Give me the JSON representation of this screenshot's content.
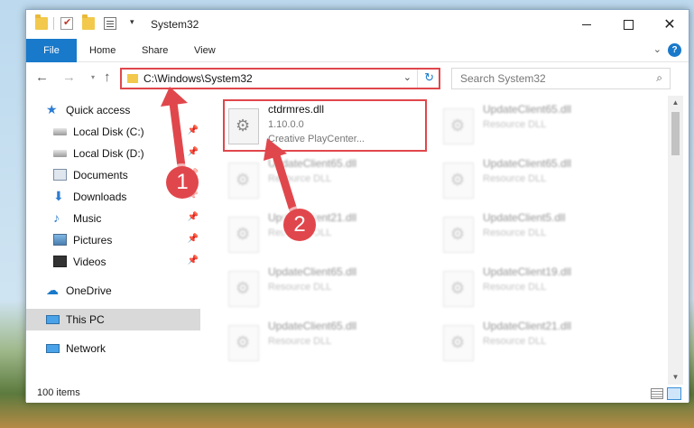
{
  "window": {
    "title": "System32",
    "controls": {
      "minimize": "minimize",
      "maximize": "maximize",
      "close": "✕"
    }
  },
  "ribbon": {
    "tabs": [
      "File",
      "Home",
      "Share",
      "View"
    ],
    "help": "?",
    "collapse_icon": "chevron-down-icon"
  },
  "nav": {
    "back": "←",
    "forward": "→",
    "recent": "▾",
    "up": "↑",
    "address": "C:\\Windows\\System32",
    "address_dropdown": "⌄",
    "refresh": "↻",
    "search_placeholder": "Search System32",
    "search_icon": "⌕"
  },
  "sidebar": {
    "items": [
      {
        "label": "Quick access",
        "icon": "star-icon",
        "pinned": false
      },
      {
        "label": "Local Disk (C:)",
        "icon": "disk-icon",
        "pinned": true
      },
      {
        "label": "Local Disk (D:)",
        "icon": "disk-icon",
        "pinned": true
      },
      {
        "label": "Documents",
        "icon": "documents-icon",
        "pinned": true
      },
      {
        "label": "Downloads",
        "icon": "download-icon",
        "pinned": true
      },
      {
        "label": "Music",
        "icon": "music-icon",
        "pinned": true
      },
      {
        "label": "Pictures",
        "icon": "pictures-icon",
        "pinned": true
      },
      {
        "label": "Videos",
        "icon": "videos-icon",
        "pinned": true
      },
      {
        "label": "OneDrive",
        "icon": "cloud-icon",
        "pinned": false
      },
      {
        "label": "This PC",
        "icon": "computer-icon",
        "pinned": false,
        "selected": true
      },
      {
        "label": "Network",
        "icon": "network-icon",
        "pinned": false
      }
    ]
  },
  "files": [
    {
      "name": "ctdrmres.dll",
      "version": "1.10.0.0",
      "description": "Creative PlayCenter...",
      "highlighted": true
    },
    {
      "name": "UpdateClient65.dll",
      "description": "Resource DLL"
    },
    {
      "name": "UpdateClient65.dll",
      "description": "Resource DLL"
    },
    {
      "name": "UpdateClient65.dll",
      "description": "Resource DLL"
    },
    {
      "name": "UpdateClient21.dll",
      "description": "Resource DLL"
    },
    {
      "name": "UpdateClient5.dll",
      "description": "Resource DLL"
    },
    {
      "name": "UpdateClient65.dll",
      "description": "Resource DLL"
    },
    {
      "name": "UpdateClient19.dll",
      "description": "Resource DLL"
    },
    {
      "name": "UpdateClient65.dll",
      "description": "Resource DLL"
    },
    {
      "name": "UpdateClient21.dll",
      "description": "Resource DLL"
    }
  ],
  "status": {
    "item_count": "100 items"
  },
  "callouts": {
    "step1": "1",
    "step2": "2"
  },
  "colors": {
    "accent": "#1979ca",
    "highlight": "#e0474c"
  }
}
